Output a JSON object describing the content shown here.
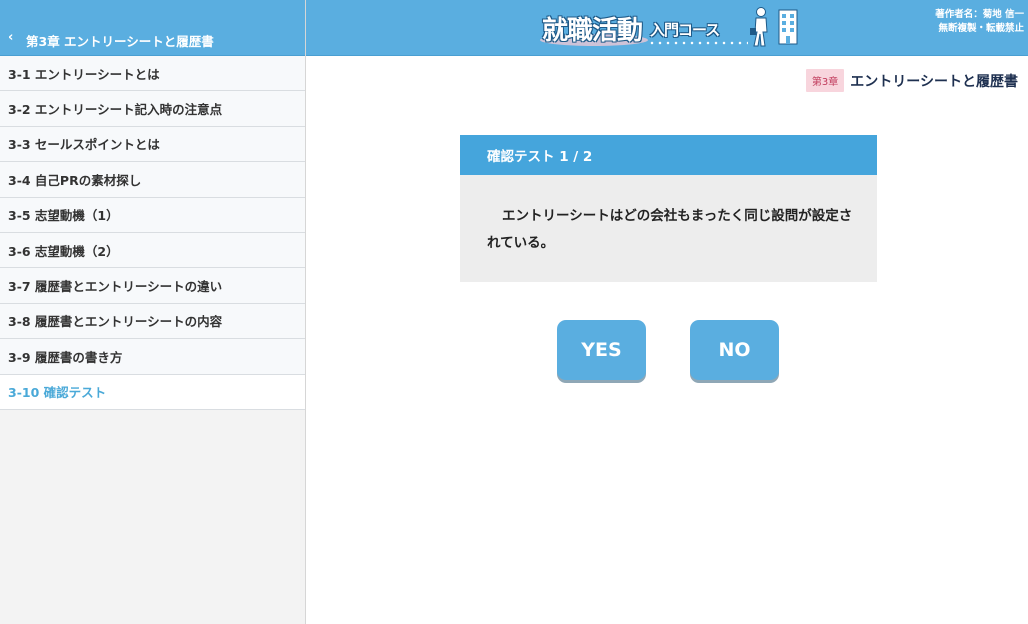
{
  "sidebar": {
    "back_icon": "chevron-left-icon",
    "back_glyph": "‹",
    "chapter_title": "第3章 エントリーシートと履歴書",
    "items": [
      {
        "label": "3-1 エントリーシートとは",
        "active": false
      },
      {
        "label": "3-2 エントリーシート記入時の注意点",
        "active": false
      },
      {
        "label": "3-3 セールスポイントとは",
        "active": false
      },
      {
        "label": "3-4 自己PRの素材探し",
        "active": false
      },
      {
        "label": "3-5 志望動機（1）",
        "active": false
      },
      {
        "label": "3-6 志望動機（2）",
        "active": false
      },
      {
        "label": "3-7 履歴書とエントリーシートの違い",
        "active": false
      },
      {
        "label": "3-8 履歴書とエントリーシートの内容",
        "active": false
      },
      {
        "label": "3-9 履歴書の書き方",
        "active": false
      },
      {
        "label": "3-10 確認テスト",
        "active": true
      }
    ]
  },
  "header": {
    "logo_main": "就職活動",
    "logo_sub": "入門コース",
    "copyright_line1": "著作者名：菊地 信一",
    "copyright_line2": "無断複製・転載禁止"
  },
  "chapter": {
    "badge": "第3章",
    "title": "エントリーシートと履歴書"
  },
  "quiz": {
    "header": "確認テスト 1 / 2",
    "question": "エントリーシートはどの会社もまったく同じ設問が設定されている。",
    "yes_label": "YES",
    "no_label": "NO"
  },
  "colors": {
    "primary": "#5aaee0",
    "quiz_header": "#45a5dc",
    "active_item": "#4aa9d8",
    "badge_bg": "#f8d5dd",
    "badge_text": "#c0395a",
    "chapter_title": "#1e3050"
  }
}
